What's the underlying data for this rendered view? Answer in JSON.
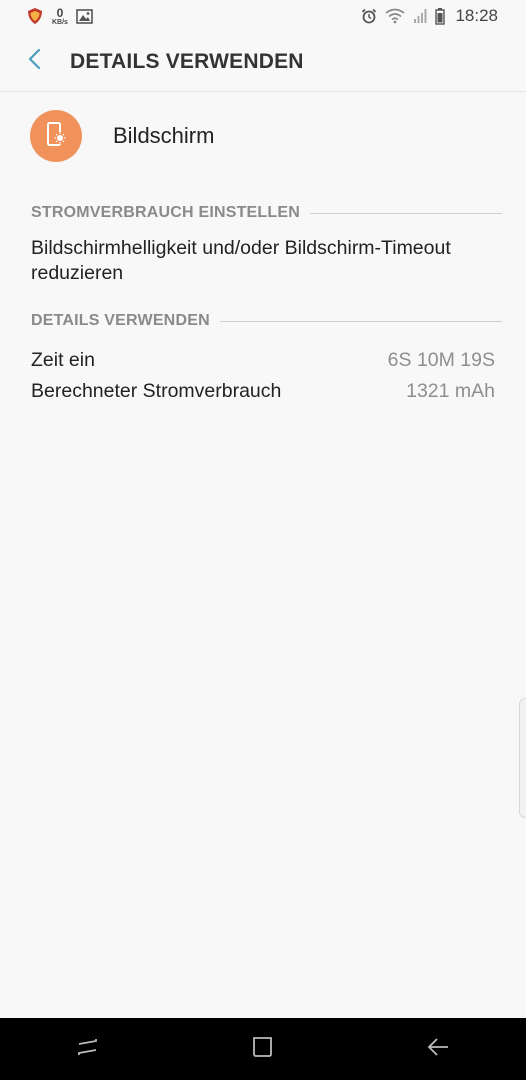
{
  "status_bar": {
    "net_speed_value": "0",
    "net_speed_unit": "KB/s",
    "time": "18:28",
    "icons": [
      "shield-app-icon",
      "net-speed",
      "image-icon",
      "alarm-icon",
      "wifi-icon",
      "signal-icon",
      "battery-icon"
    ]
  },
  "app_bar": {
    "title": "DETAILS VERWENDEN",
    "back_icon": "chevron-left-icon"
  },
  "app": {
    "name": "Bildschirm",
    "icon": "screen-brightness-icon",
    "icon_color": "#f0925a"
  },
  "sections": {
    "power": {
      "header": "STROMVERBRAUCH EINSTELLEN",
      "description": "Bildschirmhelligkeit und/oder Bildschirm-Timeout reduzieren"
    },
    "details": {
      "header": "DETAILS VERWENDEN",
      "rows": [
        {
          "label": "Zeit ein",
          "value": "6S 10M 19S"
        },
        {
          "label": "Berechneter Stromverbrauch",
          "value": "1321 mAh"
        }
      ]
    }
  },
  "nav_bar": {
    "buttons": [
      "recents-icon",
      "home-icon",
      "back-icon"
    ]
  },
  "colors": {
    "accent": "#4a9fbf",
    "background": "#f8f8f8",
    "navbar": "#000000"
  }
}
